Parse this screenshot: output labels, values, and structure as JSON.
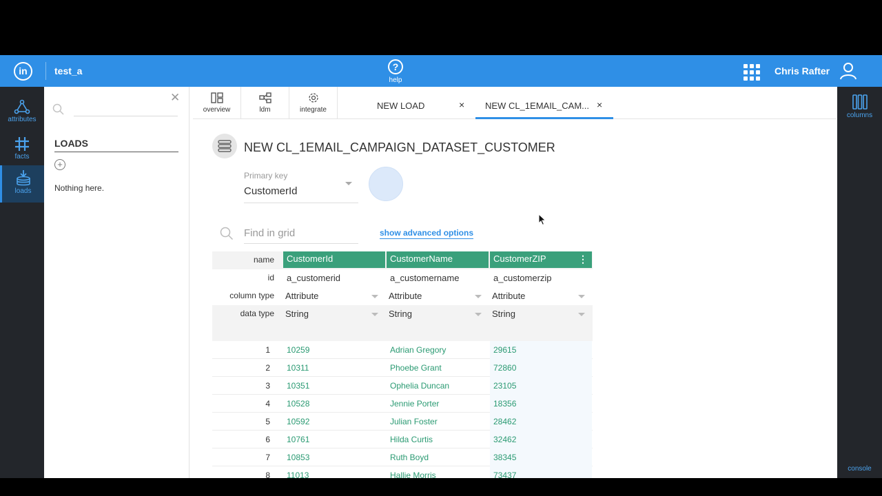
{
  "topbar": {
    "logo_text": "in",
    "project": "test_a",
    "help_label": "help",
    "user_name": "Chris Rafter",
    "accent_color": "#2f8fe6"
  },
  "leftrail": {
    "items": [
      {
        "label": "attributes",
        "icon": "attributes-icon"
      },
      {
        "label": "facts",
        "icon": "facts-icon"
      },
      {
        "label": "loads",
        "icon": "loads-icon",
        "active": true
      }
    ]
  },
  "sidepanel": {
    "title": "LOADS",
    "add_symbol": "+",
    "empty_text": "Nothing here."
  },
  "navtabs": [
    {
      "label": "overview",
      "icon": "overview-icon"
    },
    {
      "label": "ldm",
      "icon": "ldm-icon"
    },
    {
      "label": "integrate",
      "icon": "gear-icon"
    }
  ],
  "doctabs": [
    {
      "label": "NEW LOAD",
      "active": false
    },
    {
      "label": "NEW CL_1EMAIL_CAM...",
      "active": true
    }
  ],
  "dataset": {
    "title": "NEW CL_1EMAIL_CAMPAIGN_DATASET_CUSTOMER",
    "primary_key_label": "Primary key",
    "primary_key_value": "CustomerId",
    "search_placeholder": "Find in grid",
    "advanced_link": "show advanced options"
  },
  "grid": {
    "row_labels": {
      "name": "name",
      "id": "id",
      "column_type": "column type",
      "data_type": "data type"
    },
    "header_color": "#3aa07b",
    "columns": [
      {
        "name": "CustomerId",
        "id": "a_customerid",
        "column_type": "Attribute",
        "data_type": "String"
      },
      {
        "name": "CustomerName",
        "id": "a_customername",
        "column_type": "Attribute",
        "data_type": "String"
      },
      {
        "name": "CustomerZIP",
        "id": "a_customerzip",
        "column_type": "Attribute",
        "data_type": "String"
      }
    ],
    "rows": [
      {
        "n": "1",
        "v": [
          "10259",
          "Adrian Gregory",
          "29615"
        ]
      },
      {
        "n": "2",
        "v": [
          "10311",
          "Phoebe Grant",
          "72860"
        ]
      },
      {
        "n": "3",
        "v": [
          "10351",
          "Ophelia Duncan",
          "23105"
        ]
      },
      {
        "n": "4",
        "v": [
          "10528",
          "Jennie Porter",
          "18356"
        ]
      },
      {
        "n": "5",
        "v": [
          "10592",
          "Julian Foster",
          "28462"
        ]
      },
      {
        "n": "6",
        "v": [
          "10761",
          "Hilda Curtis",
          "32462"
        ]
      },
      {
        "n": "7",
        "v": [
          "10853",
          "Ruth Boyd",
          "38345"
        ]
      },
      {
        "n": "8",
        "v": [
          "11013",
          "Hallie Morris",
          "73437"
        ]
      }
    ]
  },
  "rightrail": {
    "columns_label": "columns",
    "console_label": "console"
  }
}
